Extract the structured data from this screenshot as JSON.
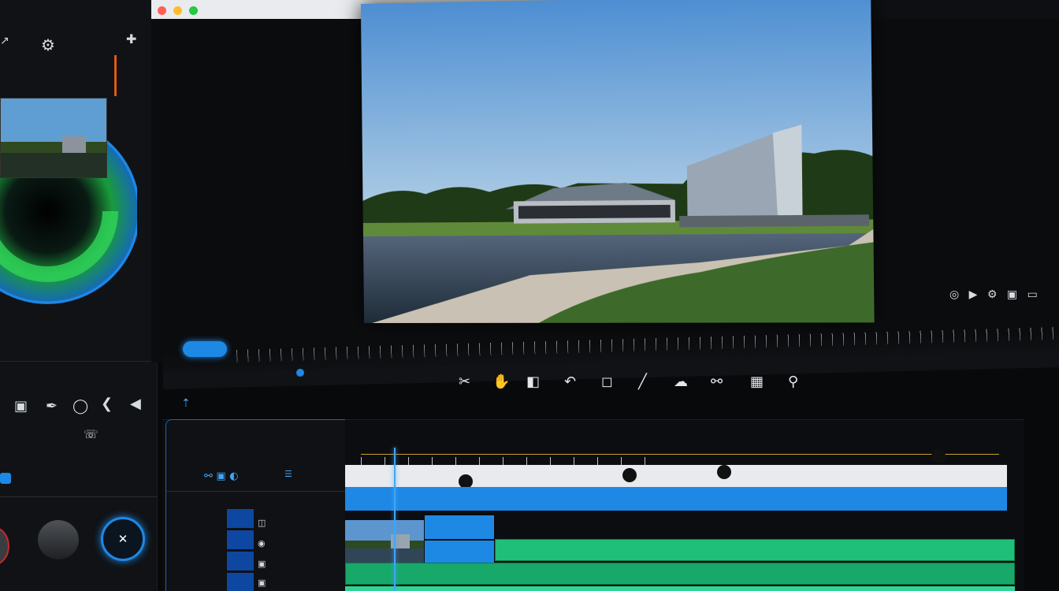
{
  "app": {
    "menu_top": [
      "",
      "",
      "",
      ""
    ],
    "menu_bar": [
      "",
      "",
      "",
      "",
      ""
    ]
  },
  "left_panel": {
    "labels": [
      "",
      "",
      "",
      "",
      "",
      ""
    ],
    "readouts": [
      "",
      "",
      ""
    ],
    "bottom_labels": [
      "",
      ""
    ]
  },
  "timeline": {
    "header_title": "",
    "track_names": [
      "",
      "",
      ""
    ],
    "clip_labels": [
      "",
      "",
      "",
      "",
      ""
    ]
  },
  "colors": {
    "accent": "#1e88e5",
    "track_green": "#1fbf7a",
    "track_white": "#e8eaed",
    "wheel_green": "#2fd45a",
    "wheel_blue": "#1976d2"
  },
  "icons": {
    "toolbar": [
      "razor-icon",
      "hand-icon",
      "ripple-icon",
      "undo-icon",
      "crop-icon",
      "pen-icon",
      "cloud-icon",
      "link-icon",
      "clapper-icon",
      "hook-icon"
    ],
    "left_tools": [
      "box-icon",
      "pen-icon",
      "circle-icon",
      "back-icon",
      "arrow-left-icon"
    ]
  }
}
